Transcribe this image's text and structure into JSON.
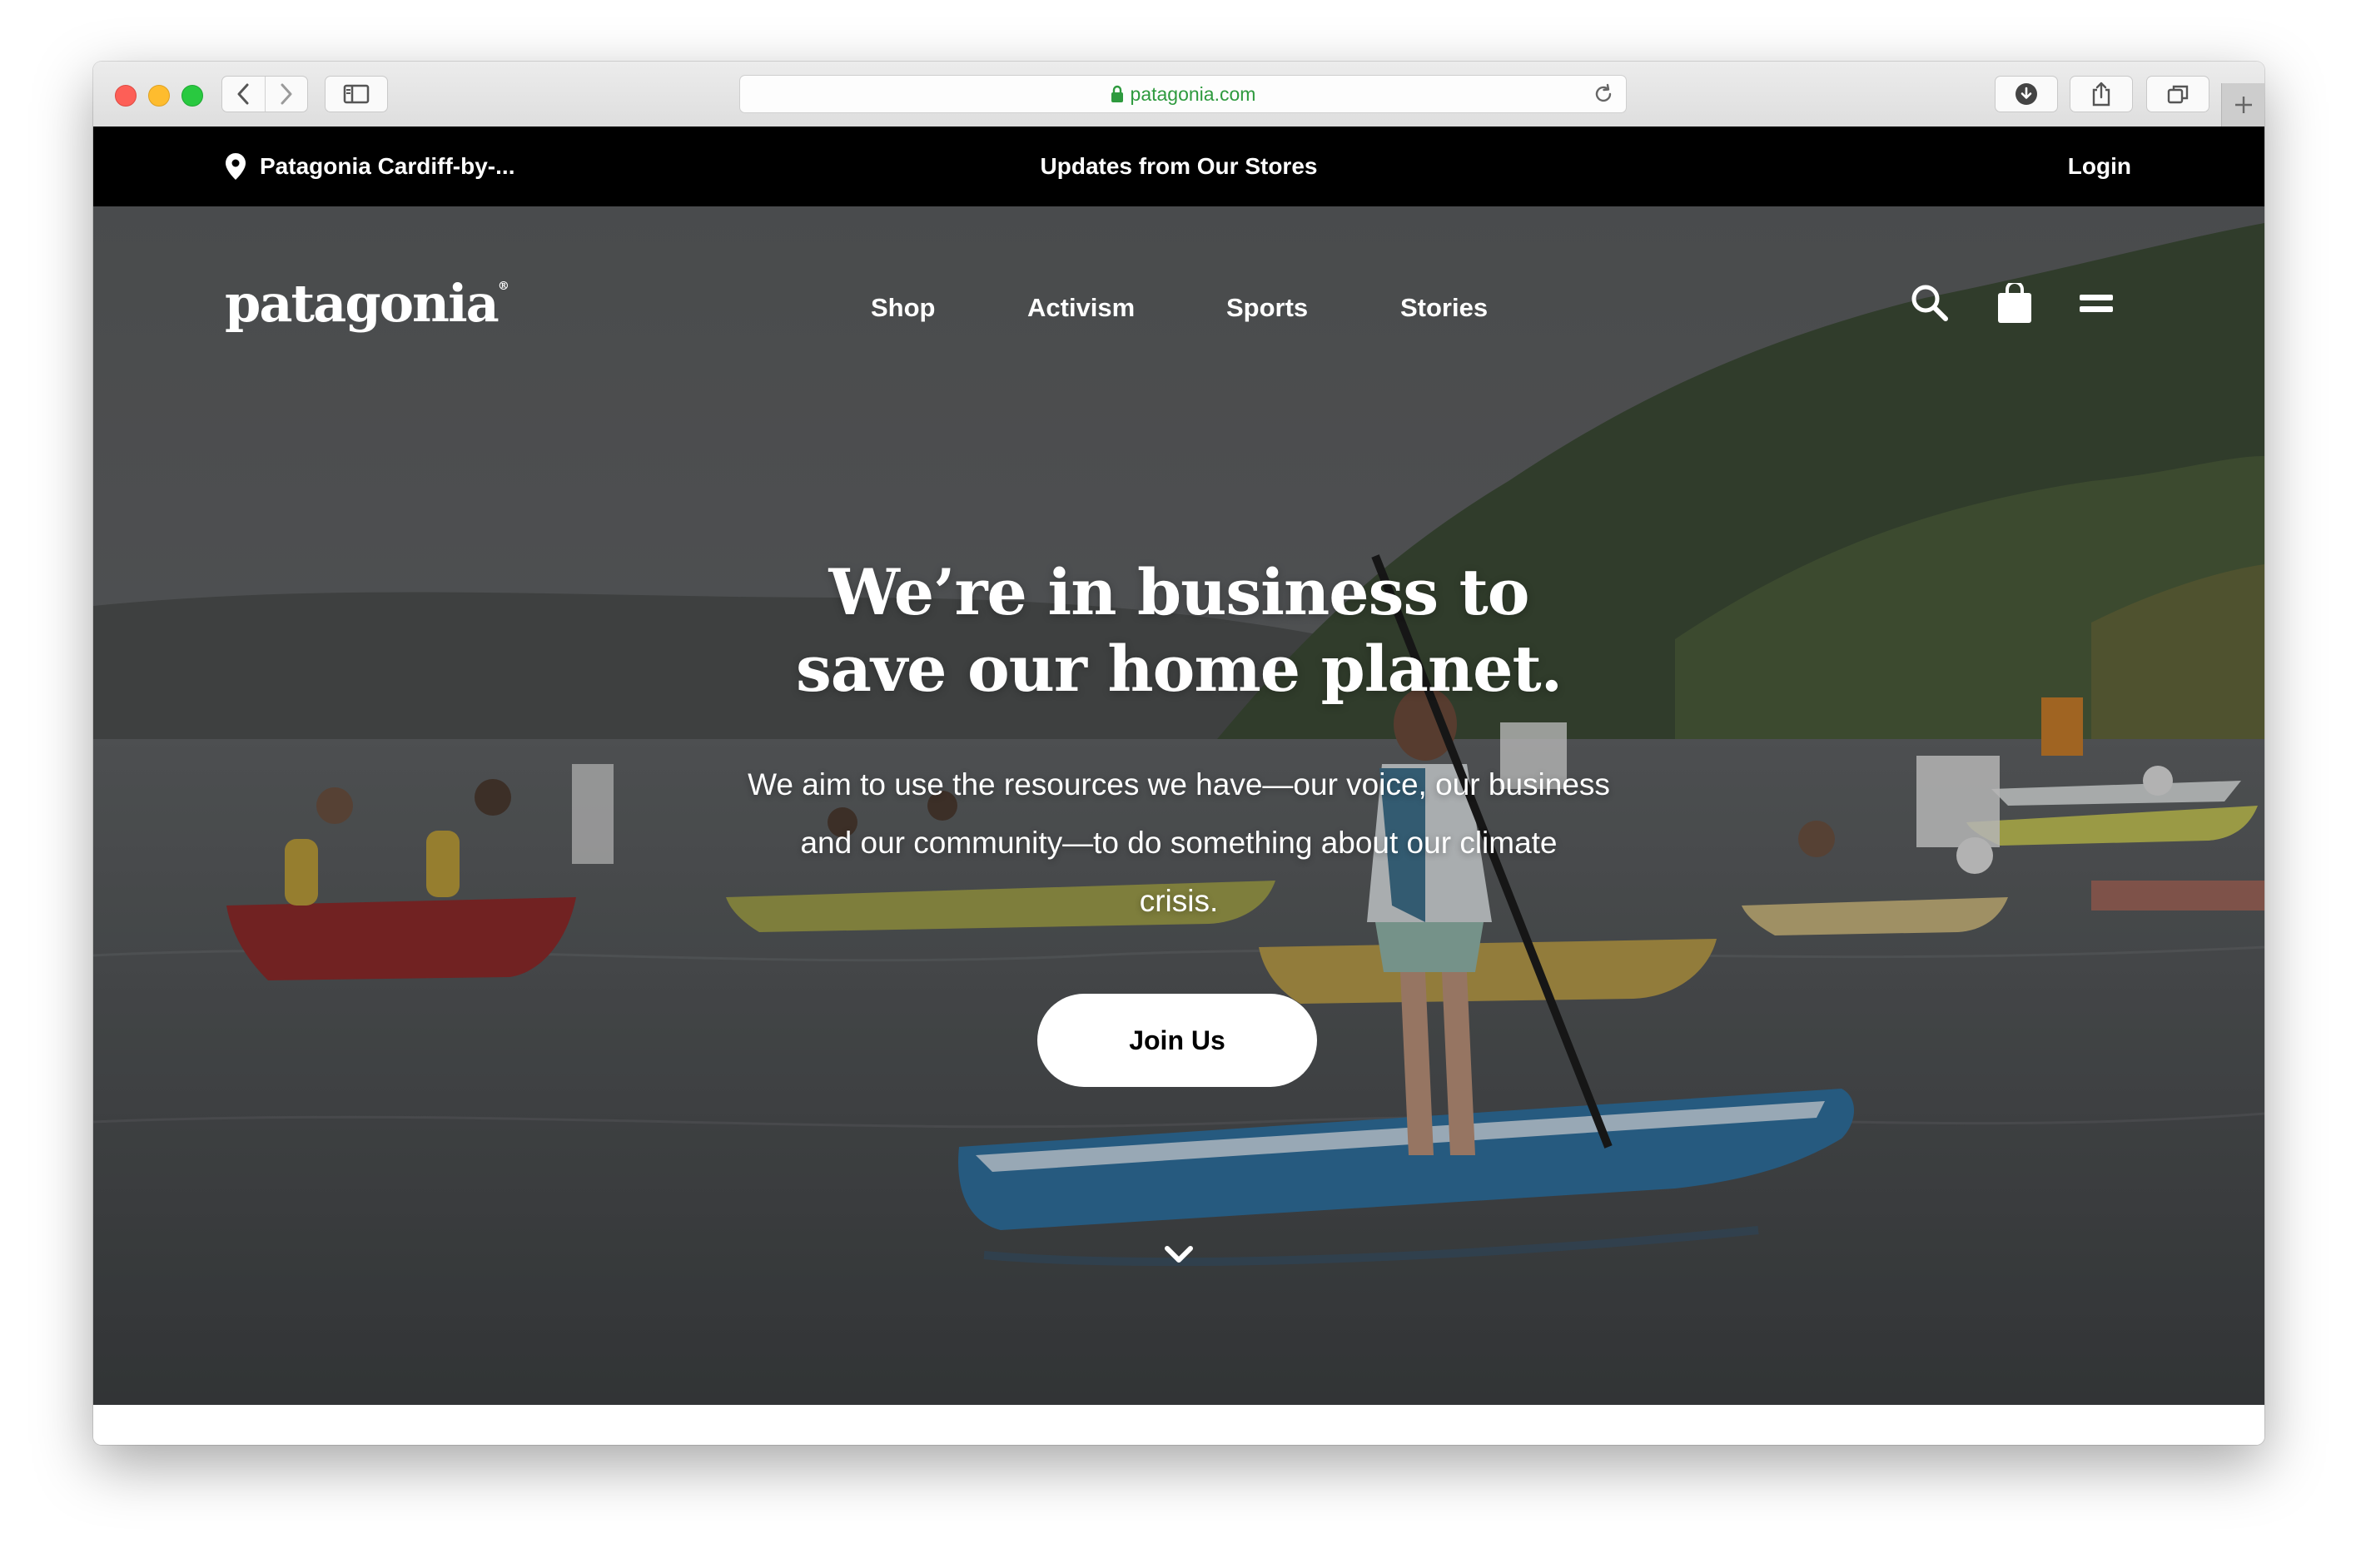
{
  "browser": {
    "url": "patagonia.com"
  },
  "topbar": {
    "store": "Patagonia Cardiff-by-...",
    "updates": "Updates from Our Stores",
    "login": "Login"
  },
  "brand": {
    "logo": "patagonia",
    "trademark": "®"
  },
  "nav": {
    "items": [
      "Shop",
      "Activism",
      "Sports",
      "Stories"
    ]
  },
  "header_icons": [
    "search-icon",
    "shopping-bag-icon",
    "menu-icon"
  ],
  "hero": {
    "headline_line1": "We’re in business to",
    "headline_line2": "save our home planet.",
    "subtext_line1": "We aim to use the resources we have—our voice, our business",
    "subtext_line2": "and our community—to do something about our climate",
    "subtext_line3": "crisis.",
    "cta": "Join Us"
  },
  "colors": {
    "topbar_bg": "#000000",
    "url_green": "#2e9a3e",
    "cta_bg": "#ffffff"
  }
}
